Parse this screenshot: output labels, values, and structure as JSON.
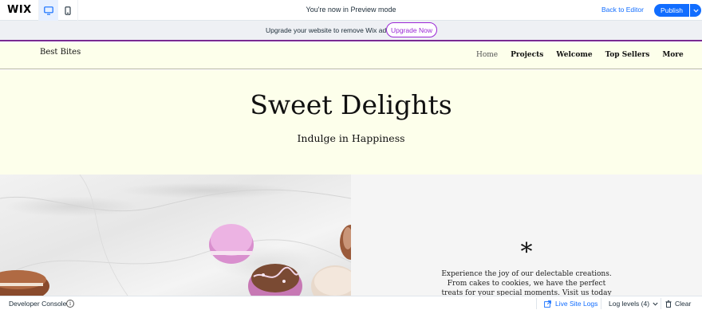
{
  "wix_bar": {
    "logo": "WIX",
    "devices": [
      {
        "name": "desktop-icon",
        "active": true
      },
      {
        "name": "mobile-icon",
        "active": false
      }
    ],
    "preview_text": "You're now in Preview mode",
    "back_to_editor": "Back to Editor",
    "publish": "Publish"
  },
  "upgrade_banner": {
    "text": "Upgrade your website to remove Wix ads",
    "button": "Upgrade Now"
  },
  "site": {
    "logo": "Best Bites",
    "nav": [
      "Home",
      "Projects",
      "Welcome",
      "Top Sellers",
      "More"
    ],
    "active_nav": "Home",
    "hero_title": "Sweet Delights",
    "hero_subtitle": "Indulge in Happiness",
    "asterisk": "*",
    "body_text": "Experience the joy of our delectable creations. From cakes to cookies, we have the perfect treats for your special moments. Visit us today for a delightful"
  },
  "dev_console": {
    "title": "Developer Console",
    "live_logs": "Live Site Logs",
    "log_levels": "Log levels (4)",
    "clear": "Clear"
  },
  "colors": {
    "wix_blue": "#116dff",
    "upgrade_purple": "#9a27d5",
    "banner_border": "#7a2b91",
    "site_bg": "#fdffeb"
  }
}
